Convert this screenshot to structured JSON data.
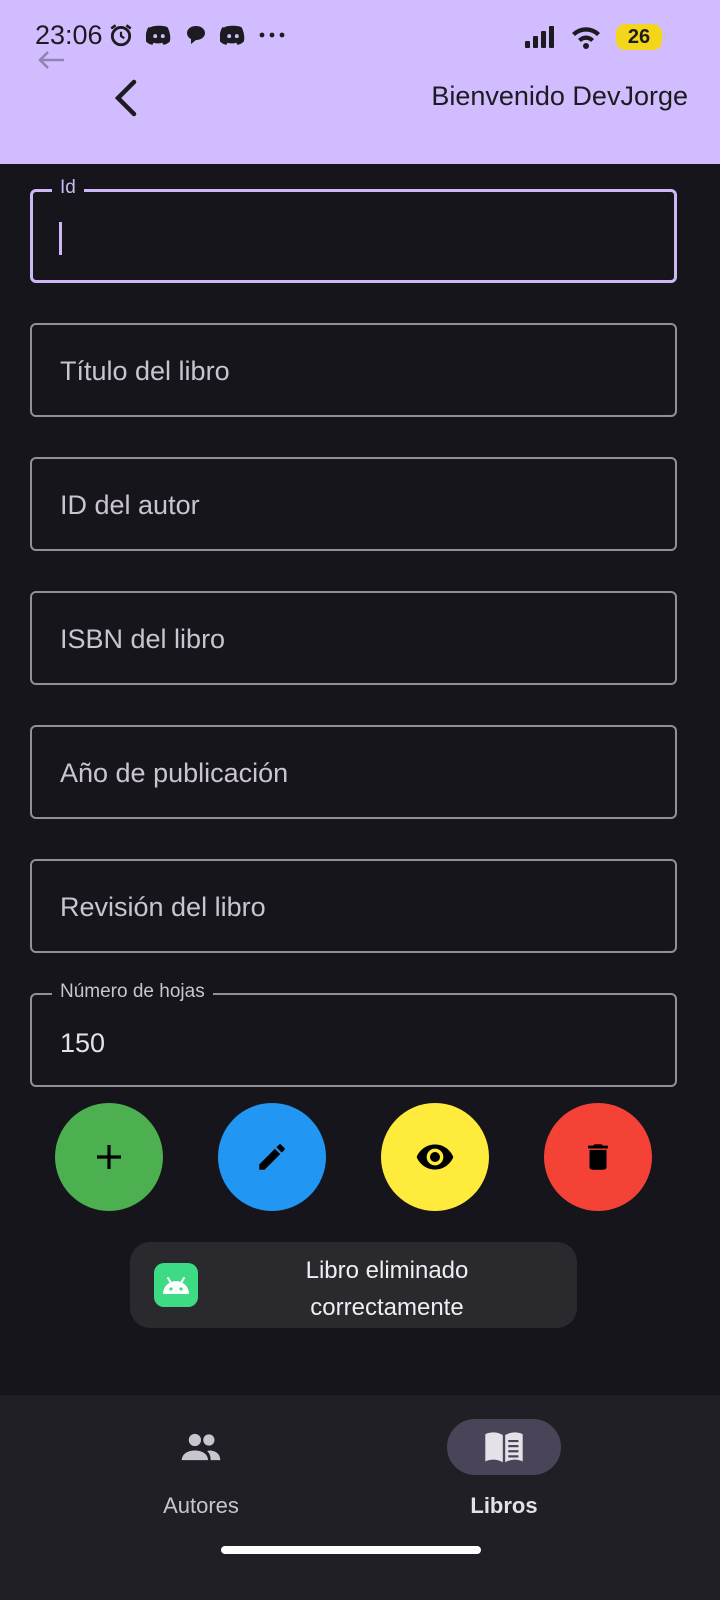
{
  "status_bar": {
    "time": "23:06",
    "battery_level": "26",
    "notification_icons": [
      "alarm-icon",
      "discord-icon",
      "chat-bubble-icon",
      "discord-icon",
      "more-icon"
    ],
    "system_icons": [
      "signal-icon",
      "wifi-icon",
      "battery-icon"
    ]
  },
  "app_bar": {
    "back_icon": "chevron-left-icon",
    "welcome_text": "Bienvenido DevJorge",
    "background": "#d0bcfe"
  },
  "form": {
    "id": {
      "label": "Id",
      "value": ""
    },
    "title": {
      "placeholder": "Título del libro"
    },
    "author_id": {
      "placeholder": "ID del autor"
    },
    "isbn": {
      "placeholder": "ISBN del libro"
    },
    "year": {
      "placeholder": "Año de publicación"
    },
    "revision": {
      "placeholder": "Revisión del libro"
    },
    "pages": {
      "label": "Número de hojas",
      "value": "150"
    }
  },
  "actions": [
    {
      "name": "add",
      "icon": "plus-icon",
      "color": "#4caf50"
    },
    {
      "name": "edit",
      "icon": "pencil-icon",
      "color": "#2196f3"
    },
    {
      "name": "view",
      "icon": "eye-icon",
      "color": "#ffeb3b"
    },
    {
      "name": "delete",
      "icon": "trash-icon",
      "color": "#f44336"
    }
  ],
  "toast": {
    "message_line1": "Libro eliminado",
    "message_line2": "correctamente",
    "icon": "android-icon"
  },
  "bottom_nav": {
    "items": [
      {
        "label": "Autores",
        "icon": "people-icon",
        "active": false
      },
      {
        "label": "Libros",
        "icon": "book-icon",
        "active": true
      }
    ]
  },
  "colors": {
    "background": "#16151b",
    "focus": "#cbb8f5",
    "outline": "#938f99"
  }
}
